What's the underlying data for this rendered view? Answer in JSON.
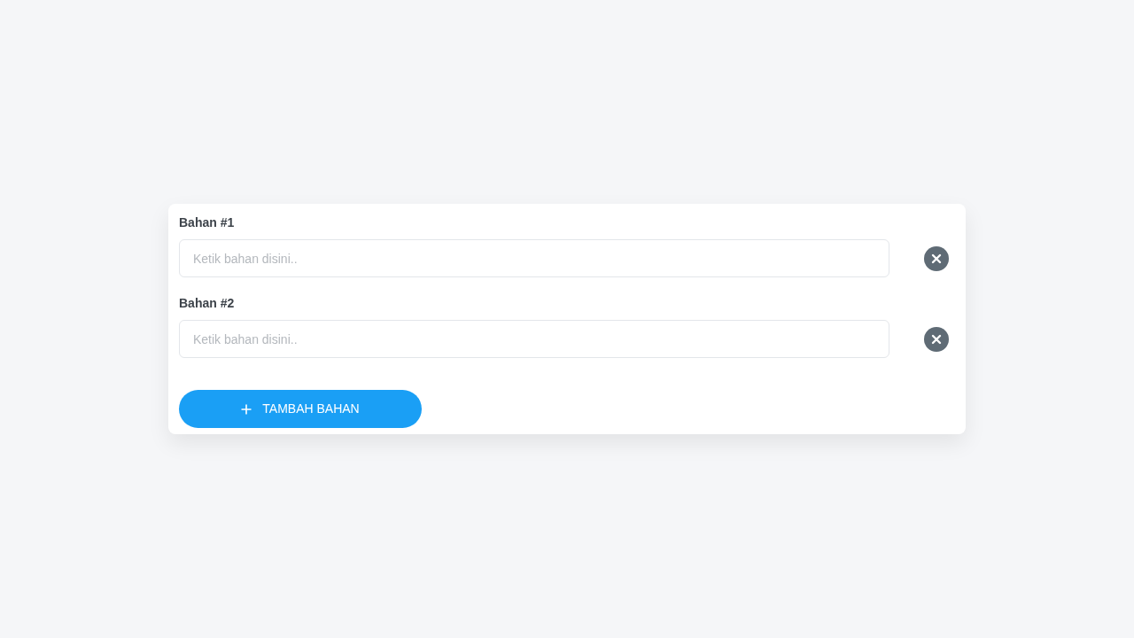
{
  "fields": [
    {
      "label": "Bahan #1",
      "placeholder": "Ketik bahan disini.."
    },
    {
      "label": "Bahan #2",
      "placeholder": "Ketik bahan disini.."
    }
  ],
  "add_button": {
    "label": "TAMBAH BAHAN"
  }
}
